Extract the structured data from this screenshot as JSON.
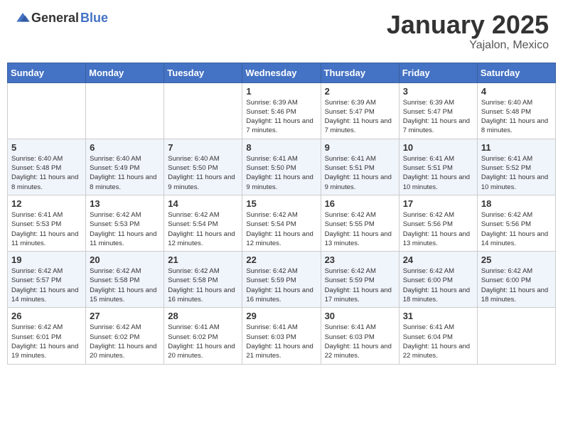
{
  "logo": {
    "general": "General",
    "blue": "Blue"
  },
  "header": {
    "month": "January 2025",
    "location": "Yajalon, Mexico"
  },
  "weekdays": [
    "Sunday",
    "Monday",
    "Tuesday",
    "Wednesday",
    "Thursday",
    "Friday",
    "Saturday"
  ],
  "weeks": [
    [
      {
        "day": "",
        "sunrise": "",
        "sunset": "",
        "daylight": ""
      },
      {
        "day": "",
        "sunrise": "",
        "sunset": "",
        "daylight": ""
      },
      {
        "day": "",
        "sunrise": "",
        "sunset": "",
        "daylight": ""
      },
      {
        "day": "1",
        "sunrise": "Sunrise: 6:39 AM",
        "sunset": "Sunset: 5:46 PM",
        "daylight": "Daylight: 11 hours and 7 minutes."
      },
      {
        "day": "2",
        "sunrise": "Sunrise: 6:39 AM",
        "sunset": "Sunset: 5:47 PM",
        "daylight": "Daylight: 11 hours and 7 minutes."
      },
      {
        "day": "3",
        "sunrise": "Sunrise: 6:39 AM",
        "sunset": "Sunset: 5:47 PM",
        "daylight": "Daylight: 11 hours and 7 minutes."
      },
      {
        "day": "4",
        "sunrise": "Sunrise: 6:40 AM",
        "sunset": "Sunset: 5:48 PM",
        "daylight": "Daylight: 11 hours and 8 minutes."
      }
    ],
    [
      {
        "day": "5",
        "sunrise": "Sunrise: 6:40 AM",
        "sunset": "Sunset: 5:48 PM",
        "daylight": "Daylight: 11 hours and 8 minutes."
      },
      {
        "day": "6",
        "sunrise": "Sunrise: 6:40 AM",
        "sunset": "Sunset: 5:49 PM",
        "daylight": "Daylight: 11 hours and 8 minutes."
      },
      {
        "day": "7",
        "sunrise": "Sunrise: 6:40 AM",
        "sunset": "Sunset: 5:50 PM",
        "daylight": "Daylight: 11 hours and 9 minutes."
      },
      {
        "day": "8",
        "sunrise": "Sunrise: 6:41 AM",
        "sunset": "Sunset: 5:50 PM",
        "daylight": "Daylight: 11 hours and 9 minutes."
      },
      {
        "day": "9",
        "sunrise": "Sunrise: 6:41 AM",
        "sunset": "Sunset: 5:51 PM",
        "daylight": "Daylight: 11 hours and 9 minutes."
      },
      {
        "day": "10",
        "sunrise": "Sunrise: 6:41 AM",
        "sunset": "Sunset: 5:51 PM",
        "daylight": "Daylight: 11 hours and 10 minutes."
      },
      {
        "day": "11",
        "sunrise": "Sunrise: 6:41 AM",
        "sunset": "Sunset: 5:52 PM",
        "daylight": "Daylight: 11 hours and 10 minutes."
      }
    ],
    [
      {
        "day": "12",
        "sunrise": "Sunrise: 6:41 AM",
        "sunset": "Sunset: 5:53 PM",
        "daylight": "Daylight: 11 hours and 11 minutes."
      },
      {
        "day": "13",
        "sunrise": "Sunrise: 6:42 AM",
        "sunset": "Sunset: 5:53 PM",
        "daylight": "Daylight: 11 hours and 11 minutes."
      },
      {
        "day": "14",
        "sunrise": "Sunrise: 6:42 AM",
        "sunset": "Sunset: 5:54 PM",
        "daylight": "Daylight: 11 hours and 12 minutes."
      },
      {
        "day": "15",
        "sunrise": "Sunrise: 6:42 AM",
        "sunset": "Sunset: 5:54 PM",
        "daylight": "Daylight: 11 hours and 12 minutes."
      },
      {
        "day": "16",
        "sunrise": "Sunrise: 6:42 AM",
        "sunset": "Sunset: 5:55 PM",
        "daylight": "Daylight: 11 hours and 13 minutes."
      },
      {
        "day": "17",
        "sunrise": "Sunrise: 6:42 AM",
        "sunset": "Sunset: 5:56 PM",
        "daylight": "Daylight: 11 hours and 13 minutes."
      },
      {
        "day": "18",
        "sunrise": "Sunrise: 6:42 AM",
        "sunset": "Sunset: 5:56 PM",
        "daylight": "Daylight: 11 hours and 14 minutes."
      }
    ],
    [
      {
        "day": "19",
        "sunrise": "Sunrise: 6:42 AM",
        "sunset": "Sunset: 5:57 PM",
        "daylight": "Daylight: 11 hours and 14 minutes."
      },
      {
        "day": "20",
        "sunrise": "Sunrise: 6:42 AM",
        "sunset": "Sunset: 5:58 PM",
        "daylight": "Daylight: 11 hours and 15 minutes."
      },
      {
        "day": "21",
        "sunrise": "Sunrise: 6:42 AM",
        "sunset": "Sunset: 5:58 PM",
        "daylight": "Daylight: 11 hours and 16 minutes."
      },
      {
        "day": "22",
        "sunrise": "Sunrise: 6:42 AM",
        "sunset": "Sunset: 5:59 PM",
        "daylight": "Daylight: 11 hours and 16 minutes."
      },
      {
        "day": "23",
        "sunrise": "Sunrise: 6:42 AM",
        "sunset": "Sunset: 5:59 PM",
        "daylight": "Daylight: 11 hours and 17 minutes."
      },
      {
        "day": "24",
        "sunrise": "Sunrise: 6:42 AM",
        "sunset": "Sunset: 6:00 PM",
        "daylight": "Daylight: 11 hours and 18 minutes."
      },
      {
        "day": "25",
        "sunrise": "Sunrise: 6:42 AM",
        "sunset": "Sunset: 6:00 PM",
        "daylight": "Daylight: 11 hours and 18 minutes."
      }
    ],
    [
      {
        "day": "26",
        "sunrise": "Sunrise: 6:42 AM",
        "sunset": "Sunset: 6:01 PM",
        "daylight": "Daylight: 11 hours and 19 minutes."
      },
      {
        "day": "27",
        "sunrise": "Sunrise: 6:42 AM",
        "sunset": "Sunset: 6:02 PM",
        "daylight": "Daylight: 11 hours and 20 minutes."
      },
      {
        "day": "28",
        "sunrise": "Sunrise: 6:41 AM",
        "sunset": "Sunset: 6:02 PM",
        "daylight": "Daylight: 11 hours and 20 minutes."
      },
      {
        "day": "29",
        "sunrise": "Sunrise: 6:41 AM",
        "sunset": "Sunset: 6:03 PM",
        "daylight": "Daylight: 11 hours and 21 minutes."
      },
      {
        "day": "30",
        "sunrise": "Sunrise: 6:41 AM",
        "sunset": "Sunset: 6:03 PM",
        "daylight": "Daylight: 11 hours and 22 minutes."
      },
      {
        "day": "31",
        "sunrise": "Sunrise: 6:41 AM",
        "sunset": "Sunset: 6:04 PM",
        "daylight": "Daylight: 11 hours and 22 minutes."
      },
      {
        "day": "",
        "sunrise": "",
        "sunset": "",
        "daylight": ""
      }
    ]
  ]
}
